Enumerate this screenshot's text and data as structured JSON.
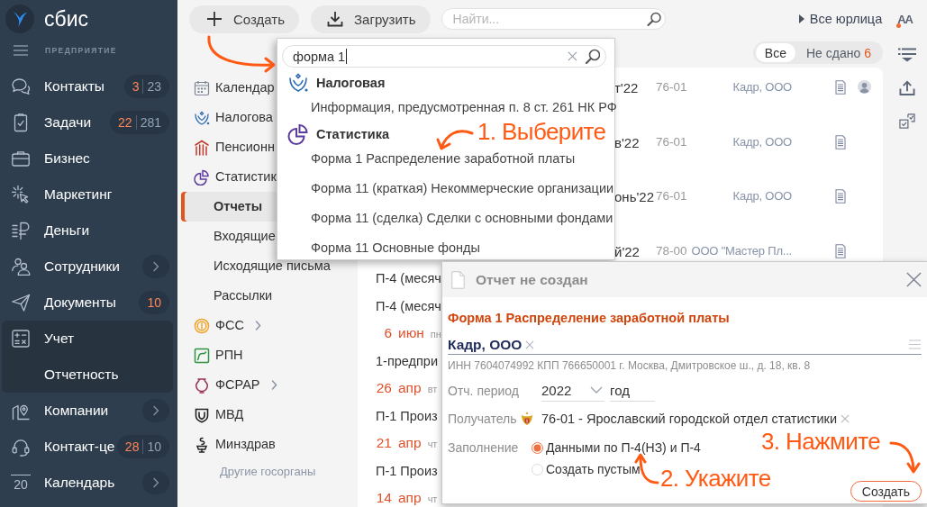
{
  "sidebar": {
    "logo": "сбис",
    "edition": "ПРЕДПРИЯТИЕ",
    "items": [
      {
        "label": "Контакты",
        "accent_count": "3",
        "total_count": "23",
        "has_submenu": false,
        "expanded": false
      },
      {
        "label": "Задачи",
        "accent_count": "22",
        "total_count": "281",
        "has_submenu": false,
        "expanded": false
      },
      {
        "label": "Бизнес",
        "has_submenu": false,
        "expanded": false
      },
      {
        "label": "Маркетинг",
        "has_submenu": false,
        "expanded": false
      },
      {
        "label": "Деньги",
        "has_submenu": false,
        "expanded": false
      },
      {
        "label": "Сотрудники",
        "has_submenu": true,
        "expanded": false
      },
      {
        "label": "Документы",
        "accent_count": "10",
        "has_submenu": false,
        "expanded": false
      },
      {
        "label": "Учет",
        "has_submenu": false,
        "expanded": true,
        "children": [
          {
            "label": "Отчетность"
          }
        ]
      },
      {
        "label": "Компании",
        "has_submenu": true,
        "expanded": false
      },
      {
        "label": "Контакт-це",
        "accent_count": "28",
        "total_count": "10",
        "has_submenu": false,
        "expanded": false
      },
      {
        "label": "Календарь",
        "day": "20",
        "has_submenu": true,
        "expanded": false
      }
    ]
  },
  "toolbar": {
    "create": "Создать",
    "upload": "Загрузить",
    "search_placeholder": "Найти...",
    "org_filter": "Все юрлица",
    "text_size": "AA"
  },
  "section_nav": {
    "items": [
      {
        "label": "Календар",
        "selected": false,
        "has_submenu": false
      },
      {
        "label": "Налогова",
        "selected": false,
        "has_submenu": false
      },
      {
        "label": "Пенсионн",
        "selected": false,
        "has_submenu": false
      },
      {
        "label": "Статистик",
        "selected": false,
        "has_submenu": false,
        "children": [
          {
            "label": "Отчеты",
            "selected": true
          },
          {
            "label": "Входящие",
            "selected": false
          },
          {
            "label": "Исходящие письма",
            "selected": false
          },
          {
            "label": "Рассылки",
            "selected": false
          }
        ]
      },
      {
        "label": "ФСС",
        "selected": false,
        "has_submenu": true
      },
      {
        "label": "РПН",
        "selected": false,
        "has_submenu": false
      },
      {
        "label": "ФСРАР",
        "selected": false,
        "has_submenu": true
      },
      {
        "label": "МВД",
        "selected": false,
        "has_submenu": false
      },
      {
        "label": "Минздрав",
        "selected": false,
        "has_submenu": false
      }
    ],
    "more_link": "Другие госорганы"
  },
  "reports": {
    "filters": [
      {
        "label": "Все",
        "selected": true
      },
      {
        "label": "Не сдано",
        "count": "6",
        "selected": false
      }
    ],
    "rows": [
      {
        "kind": "report",
        "period": "т'22",
        "code": "76-01",
        "org": "Кадр, ООО",
        "document": true,
        "avatar": true
      },
      {
        "kind": "report",
        "period": "в'22",
        "code": "76-01",
        "org": "Кадр, ООО",
        "document": true,
        "avatar": false
      },
      {
        "kind": "report",
        "period": "онь'22",
        "code": "76-01",
        "org": "Кадр, ООО",
        "document": true,
        "avatar": false
      },
      {
        "kind": "report",
        "period": "й'22",
        "code": "78-00",
        "org": "ООО \"Мастер Пл...",
        "document": true,
        "avatar": false
      },
      {
        "kind": "report",
        "title": "П-4 (месяч"
      },
      {
        "kind": "report",
        "title": "П-4 (месяч"
      },
      {
        "kind": "date",
        "day": "6",
        "month": "июн",
        "weekday": "пн"
      },
      {
        "kind": "report",
        "title": "1-предпри"
      },
      {
        "kind": "date",
        "day": "26",
        "month": "апр",
        "weekday": "вт"
      },
      {
        "kind": "report",
        "title": "П-1 Произ"
      },
      {
        "kind": "date",
        "day": "21",
        "month": "апр",
        "weekday": "чт"
      },
      {
        "kind": "report",
        "title": "П-1 Произ"
      },
      {
        "kind": "date",
        "day": "14",
        "month": "апр",
        "weekday": "чт"
      }
    ]
  },
  "search_popup": {
    "query": "форма 1",
    "groups": [
      {
        "title": "Налоговая",
        "items": [
          "Информация, предусмотренная п. 8 ст. 261 НК РФ"
        ]
      },
      {
        "title": "Статистика",
        "items": [
          "Форма 1 Распределение заработной платы",
          "Форма 11 (краткая) Некоммерческие организации",
          "Форма 11 (сделка) Сделки с основными фондами",
          "Форма 11 Основные фонды"
        ]
      }
    ]
  },
  "dialog": {
    "title": "Отчет не создан",
    "report_name": "Форма 1 Распределение заработной платы",
    "organization": "Кадр, ООО",
    "organization_details": "ИНН 7604074992 КПП 766650001 г. Москва, Дмитровское ш., д. 18, кв. 8",
    "fields": [
      {
        "kind": "period",
        "label": "Отч. период",
        "year": "2022",
        "unit": "год"
      },
      {
        "kind": "recipient",
        "label": "Получатель",
        "value": "76-01 - Ярославский городской отдел статистики"
      },
      {
        "kind": "choice",
        "label": "Заполнение",
        "options": [
          {
            "label": "Данными по П-4(НЗ) и П-4",
            "selected": true
          },
          {
            "label": "Создать пустым",
            "selected": false
          }
        ]
      }
    ],
    "submit": "Создать"
  },
  "annotations": [
    {
      "text": "1. Выберите"
    },
    {
      "text": "2. Укажите"
    },
    {
      "text": "3. Нажмите"
    }
  ]
}
